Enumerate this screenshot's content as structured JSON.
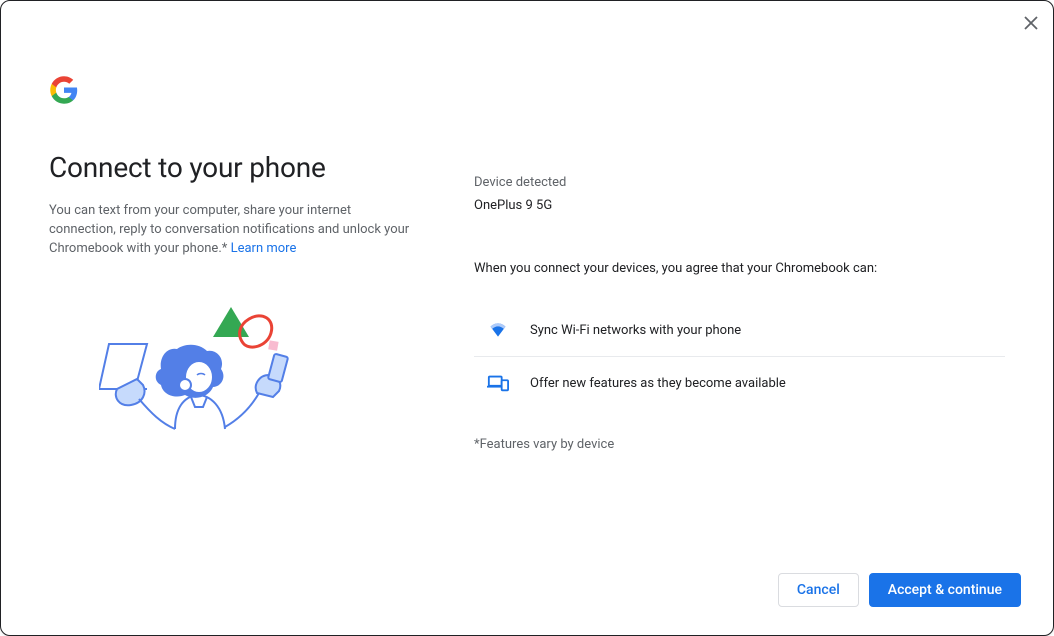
{
  "heading": "Connect to your phone",
  "description": "You can text from your computer, share your internet connection, reply to conversation notifications and unlock your Chromebook with your phone.* ",
  "learn_more": "Learn more",
  "device_detected_label": "Device detected",
  "device_name": "OnePlus 9 5G",
  "agree_text": "When you connect your devices, you agree that your Chromebook can:",
  "features": [
    {
      "text": "Sync Wi-Fi networks with your phone"
    },
    {
      "text": "Offer new features as they become available"
    }
  ],
  "footnote": "*Features vary by device",
  "buttons": {
    "cancel": "Cancel",
    "accept": "Accept & continue"
  }
}
